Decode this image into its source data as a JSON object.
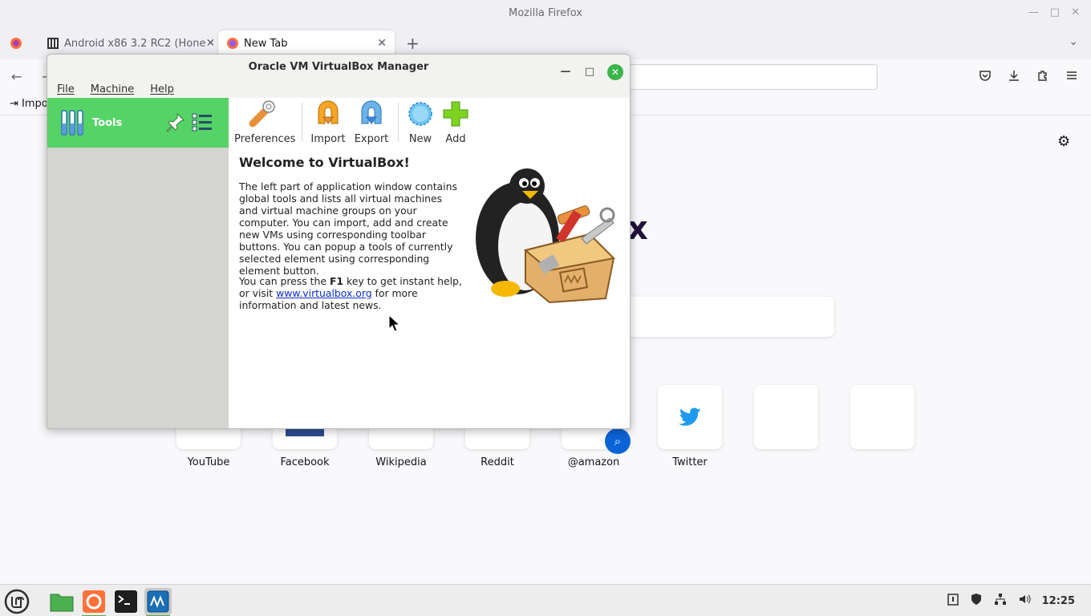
{
  "firefox": {
    "window_title": "Mozilla Firefox",
    "tabs": [
      {
        "label": "Android x86 3.2 RC2 (Hone"
      },
      {
        "label": "New Tab"
      }
    ],
    "bookmark_label": "Impo",
    "logo_fragment": "x",
    "top_sites": [
      {
        "label": "YouTube"
      },
      {
        "label": "Facebook"
      },
      {
        "label": "Wikipedia"
      },
      {
        "label": "Reddit"
      },
      {
        "label": "@amazon"
      },
      {
        "label": "Twitter"
      }
    ]
  },
  "virtualbox": {
    "title": "Oracle VM VirtualBox Manager",
    "menu": [
      "File",
      "Machine",
      "Help"
    ],
    "tools_label": "Tools",
    "toolbar": {
      "preferences": "Preferences",
      "import": "Import",
      "export": "Export",
      "new": "New",
      "add": "Add"
    },
    "welcome_title": "Welcome to VirtualBox!",
    "welcome_p1": "The left part of application window contains global tools and lists all virtual machines and virtual machine groups on your computer. You can import, add and create new VMs using corresponding toolbar buttons. You can popup a tools of currently selected element using corresponding element button.",
    "welcome_p2_a": "You can press the ",
    "welcome_p2_key": "F1",
    "welcome_p2_b": " key to get instant help, or visit ",
    "welcome_p2_link": "www.virtualbox.org",
    "welcome_p2_c": " for more information and latest news."
  },
  "taskbar": {
    "clock": "12:25",
    "apps": [
      "menu-icon",
      "files-icon",
      "firefox-icon",
      "terminal-icon",
      "virtualbox-icon"
    ]
  },
  "colors": {
    "tools_green": "#55d366",
    "close_green": "#3cb54a",
    "link_blue": "#0b2fc8"
  }
}
